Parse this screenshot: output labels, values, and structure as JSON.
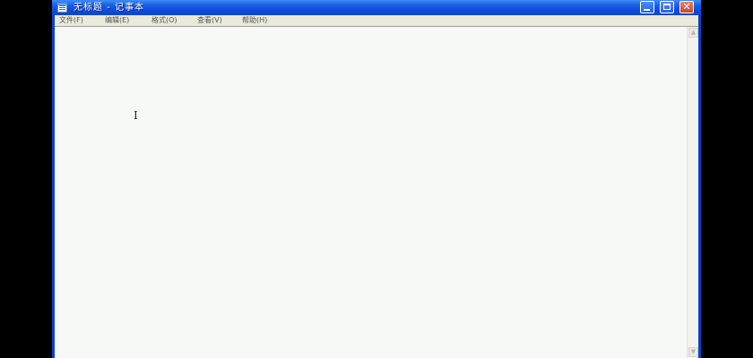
{
  "window": {
    "title": "无标题 - 记事本",
    "icon": "notepad-icon",
    "controls": {
      "minimize": "minimize-icon",
      "maximize": "maximize-icon",
      "close": "close-icon",
      "close_glyph": "✕"
    }
  },
  "menu": {
    "items": [
      {
        "label": "文件(F)"
      },
      {
        "label": "编辑(E)"
      },
      {
        "label": "格式(O)"
      },
      {
        "label": "查看(V)"
      },
      {
        "label": "帮助(H)"
      }
    ]
  },
  "editor": {
    "content": "",
    "cursor_glyph": "I",
    "cursor_icon": "text-cursor-icon"
  },
  "scrollbar": {
    "up_glyph": "▲",
    "down_glyph": "▼"
  },
  "colors": {
    "titlebar": "#0b4bd8",
    "frame": "#0842c8",
    "menubar": "#ece9d8",
    "editor_bg": "#f7f9f7",
    "close_button": "#c8452a"
  }
}
